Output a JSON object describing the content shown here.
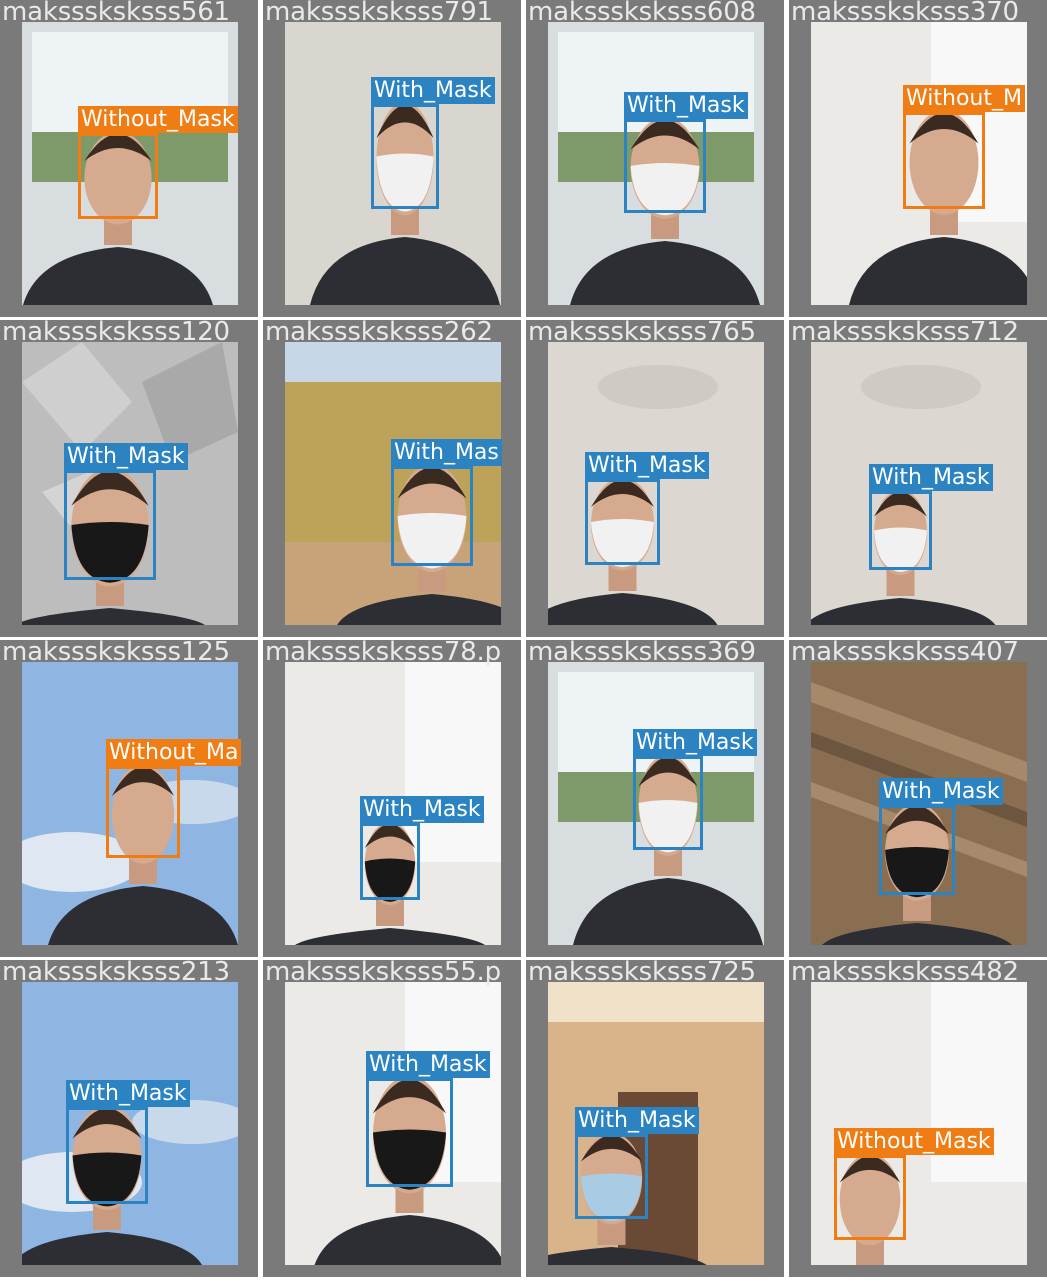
{
  "colors": {
    "with_mask": "#2b83c2",
    "without_mask": "#f07d14",
    "tile_border": "#7a7a7a",
    "filename_text": "#e9e9e9"
  },
  "tiles": [
    {
      "filename": "maksssksksss561",
      "scene": "window",
      "mask": "none",
      "detection": {
        "label": "Without_Mask",
        "class": "without"
      }
    },
    {
      "filename": "maksssksksss791",
      "scene": "wall",
      "mask": "white",
      "detection": {
        "label": "With_Mask",
        "class": "with"
      }
    },
    {
      "filename": "maksssksksss608",
      "scene": "window",
      "mask": "white",
      "detection": {
        "label": "With_Mask",
        "class": "with"
      }
    },
    {
      "filename": "maksssksksss370",
      "scene": "bright",
      "mask": "none",
      "detection": {
        "label": "Without_M",
        "class": "without"
      }
    },
    {
      "filename": "maksssksksss120",
      "scene": "grey",
      "mask": "black",
      "detection": {
        "label": "With_Mask",
        "class": "with"
      }
    },
    {
      "filename": "maksssksksss262",
      "scene": "fence",
      "mask": "white",
      "detection": {
        "label": "With_Mas",
        "class": "with"
      }
    },
    {
      "filename": "maksssksksss765",
      "scene": "room",
      "mask": "white",
      "detection": {
        "label": "With_Mask",
        "class": "with"
      }
    },
    {
      "filename": "maksssksksss712",
      "scene": "room",
      "mask": "white",
      "detection": {
        "label": "With_Mask",
        "class": "with"
      }
    },
    {
      "filename": "maksssksksss125",
      "scene": "sky",
      "mask": "none",
      "detection": {
        "label": "Without_Ma",
        "class": "without"
      }
    },
    {
      "filename": "maksssksksss78.p",
      "scene": "bright",
      "mask": "black",
      "detection": {
        "label": "With_Mask",
        "class": "with"
      }
    },
    {
      "filename": "maksssksksss369",
      "scene": "window",
      "mask": "white",
      "detection": {
        "label": "With_Mask",
        "class": "with"
      }
    },
    {
      "filename": "maksssksksss407",
      "scene": "wood",
      "mask": "black",
      "detection": {
        "label": "With_Mask",
        "class": "with"
      }
    },
    {
      "filename": "maksssksksss213",
      "scene": "sky",
      "mask": "black",
      "detection": {
        "label": "With_Mask",
        "class": "with"
      }
    },
    {
      "filename": "maksssksksss55.p",
      "scene": "bright",
      "mask": "black",
      "detection": {
        "label": "With_Mask",
        "class": "with"
      }
    },
    {
      "filename": "maksssksksss725",
      "scene": "brick",
      "mask": "blue",
      "detection": {
        "label": "With_Mask",
        "class": "with"
      }
    },
    {
      "filename": "maksssksksss482",
      "scene": "bright",
      "mask": "none",
      "detection": {
        "label": "Without_Mask",
        "class": "without"
      }
    }
  ]
}
